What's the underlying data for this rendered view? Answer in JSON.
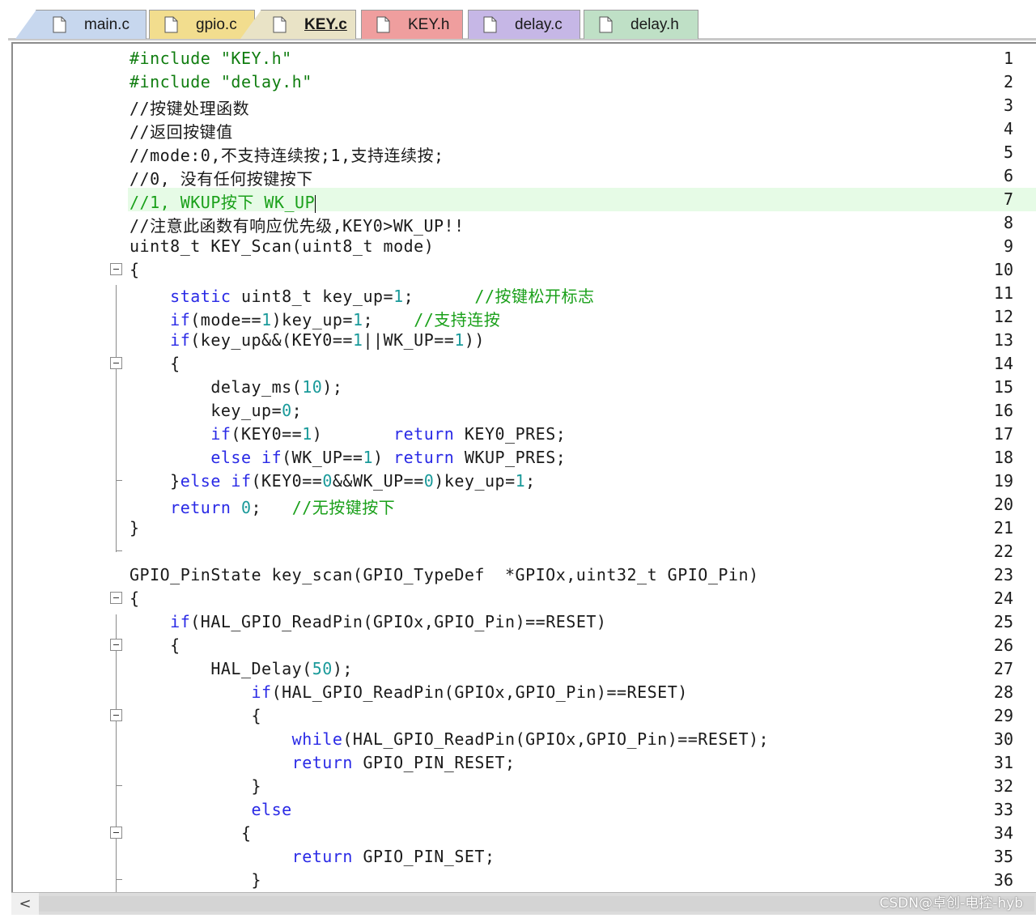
{
  "tabs": [
    {
      "label": "main.c",
      "color": "#c7d7ee",
      "active": false
    },
    {
      "label": "gpio.c",
      "color": "#f2dd8e",
      "active": false
    },
    {
      "label": "KEY.c",
      "color": "#e9e3c6",
      "active": true
    },
    {
      "label": "KEY.h",
      "color": "#ef9e9e",
      "active": false
    },
    {
      "label": "delay.c",
      "color": "#c6b7e6",
      "active": false
    },
    {
      "label": "delay.h",
      "color": "#bfe0c6",
      "active": false
    }
  ],
  "editor": {
    "current_line": 7,
    "lines": [
      {
        "n": "1"
      },
      {
        "n": "2"
      },
      {
        "n": "3"
      },
      {
        "n": "4"
      },
      {
        "n": "5"
      },
      {
        "n": "6"
      },
      {
        "n": "7"
      },
      {
        "n": "8"
      },
      {
        "n": "9"
      },
      {
        "n": "10"
      },
      {
        "n": "11"
      },
      {
        "n": "12"
      },
      {
        "n": "13"
      },
      {
        "n": "14"
      },
      {
        "n": "15"
      },
      {
        "n": "16"
      },
      {
        "n": "17"
      },
      {
        "n": "18"
      },
      {
        "n": "19"
      },
      {
        "n": "20"
      },
      {
        "n": "21"
      },
      {
        "n": "22"
      },
      {
        "n": "23"
      },
      {
        "n": "24"
      },
      {
        "n": "25"
      },
      {
        "n": "26"
      },
      {
        "n": "27"
      },
      {
        "n": "28"
      },
      {
        "n": "29"
      },
      {
        "n": "30"
      },
      {
        "n": "31"
      },
      {
        "n": "32"
      },
      {
        "n": "33"
      },
      {
        "n": "34"
      },
      {
        "n": "35"
      },
      {
        "n": "36"
      }
    ],
    "code": {
      "l1a": "#include ",
      "l1b": "\"KEY.h\"",
      "l2a": "#include ",
      "l2b": "\"delay.h\"",
      "l3": "//按键处理函数",
      "l4": "//返回按键值",
      "l5": "//mode:0,不支持连续按;1,支持连续按;",
      "l6": "//0, 没有任何按键按下",
      "l7": "//1, WKUP按下 WK_UP",
      "l8": "//注意此函数有响应优先级,KEY0>WK_UP!!",
      "l9": "uint8_t KEY_Scan(uint8_t mode)",
      "l10": "{",
      "l11a": "static",
      "l11b": " uint8_t key_up=",
      "l11c": "1",
      "l11d": ";      ",
      "l11e": "//按键松开标志",
      "l12a": "if",
      "l12b": "(mode==",
      "l12c": "1",
      "l12d": ")key_up=",
      "l12e": "1",
      "l12f": ";    ",
      "l12g": "//支持连按",
      "l13a": "if",
      "l13b": "(key_up&&(KEY0==",
      "l13c": "1",
      "l13d": "||WK_UP==",
      "l13e": "1",
      "l13f": "))",
      "l14": "{",
      "l15a": "delay_ms(",
      "l15b": "10",
      "l15c": ");",
      "l16a": "key_up=",
      "l16b": "0",
      "l16c": ";",
      "l17a": "if",
      "l17b": "(KEY0==",
      "l17c": "1",
      "l17d": ")       ",
      "l17e": "return",
      "l17f": " KEY0_PRES;",
      "l18a": "else if",
      "l18b": "(WK_UP==",
      "l18c": "1",
      "l18d": ") ",
      "l18e": "return",
      "l18f": " WKUP_PRES;",
      "l19a": "}",
      "l19b": "else if",
      "l19c": "(KEY0==",
      "l19d": "0",
      "l19e": "&&WK_UP==",
      "l19f": "0",
      "l19g": ")key_up=",
      "l19h": "1",
      "l19i": ";",
      "l20a": "return",
      "l20b": " ",
      "l20c": "0",
      "l20d": ";   ",
      "l20e": "//无按键按下",
      "l21": "}",
      "l23": "GPIO_PinState key_scan(GPIO_TypeDef  *GPIOx,uint32_t GPIO_Pin)",
      "l24": "{",
      "l25a": "if",
      "l25b": "(HAL_GPIO_ReadPin(GPIOx,GPIO_Pin)==RESET)",
      "l26": "{",
      "l27a": "HAL_Delay(",
      "l27b": "50",
      "l27c": ");",
      "l28a": "if",
      "l28b": "(HAL_GPIO_ReadPin(GPIOx,GPIO_Pin)==RESET)",
      "l29": "{",
      "l30a": "while",
      "l30b": "(HAL_GPIO_ReadPin(GPIOx,GPIO_Pin)==RESET);",
      "l31a": "return",
      "l31b": " GPIO_PIN_RESET;",
      "l32": "}",
      "l33": "else",
      "l34": "{",
      "l35a": "return",
      "l35b": " GPIO_PIN_SET;",
      "l36": "}"
    }
  },
  "scrollbar": {
    "left_arrow": "<"
  },
  "watermark": "CSDN@卓创-电控-hyb",
  "colors": {
    "keyword": "#2a2ae6",
    "comment": "#1aa01a",
    "number": "#1a9a9a",
    "current_line": "#e6fbe6"
  }
}
